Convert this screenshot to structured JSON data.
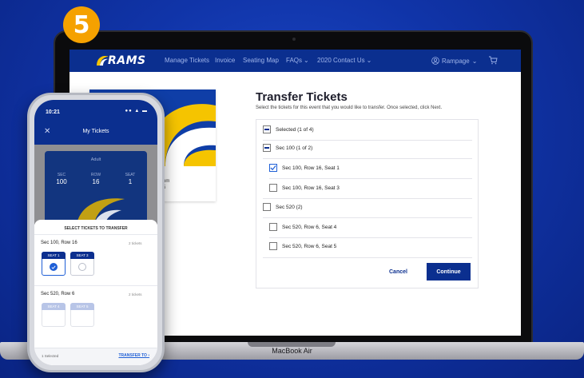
{
  "step_badge": "5",
  "laptop": {
    "label": "MacBook Air"
  },
  "site": {
    "logo_text": "RAMS",
    "nav": [
      {
        "label": "Manage Tickets"
      },
      {
        "label": "Invoice"
      },
      {
        "label": "Seating Map"
      },
      {
        "label": "FAQs"
      },
      {
        "label": "2020 Contact Us"
      }
    ],
    "user_label": "Rampage",
    "card_partial_text": [
      "om",
      "5"
    ]
  },
  "transfer": {
    "title": "Transfer Tickets",
    "subtitle": "Select the tickets for this event that you would like to transfer. Once selected, click Next.",
    "selected_label": "Selected (1 of 4)",
    "sections": [
      {
        "label": "Sec 100 (1 of 2)",
        "seats": [
          {
            "label": "Sec 100, Row 16, Seat 1",
            "checked": true
          },
          {
            "label": "Sec 100, Row 16, Seat 3",
            "checked": false
          }
        ]
      },
      {
        "label": "Sec 520 (2)",
        "seats": [
          {
            "label": "Sec 520, Row 6, Seat 4",
            "checked": false
          },
          {
            "label": "Sec 520, Row 6, Seat 5",
            "checked": false
          }
        ]
      }
    ],
    "cancel_label": "Cancel",
    "continue_label": "Continue"
  },
  "phone": {
    "time": "10:21",
    "header_title": "My Tickets",
    "ticket": {
      "type": "Adult",
      "sec_label": "SEC",
      "sec_value": "100",
      "row_label": "ROW",
      "row_value": "16",
      "seat_label": "SEAT",
      "seat_value": "1"
    },
    "sheet_title": "SELECT TICKETS TO TRANSFER",
    "groups": [
      {
        "label": "Sec 100, Row 16",
        "count": "2 tickets",
        "seats": [
          {
            "label": "SEAT 1",
            "selected": true
          },
          {
            "label": "SEAT 3",
            "selected": false
          }
        ]
      },
      {
        "label": "Sec 520, Row 6",
        "count": "2 tickets",
        "seats": [
          {
            "label": "SEAT 4",
            "selected": false
          },
          {
            "label": "SEAT 5",
            "selected": false
          }
        ]
      }
    ],
    "footer_selected": "1 Selected",
    "footer_transfer": "TRANSFER TO"
  },
  "colors": {
    "brand_blue": "#0b2f8f",
    "badge_orange": "#f5a100",
    "horn_yellow": "#f5c400",
    "accent_blue": "#1f5fd6"
  }
}
